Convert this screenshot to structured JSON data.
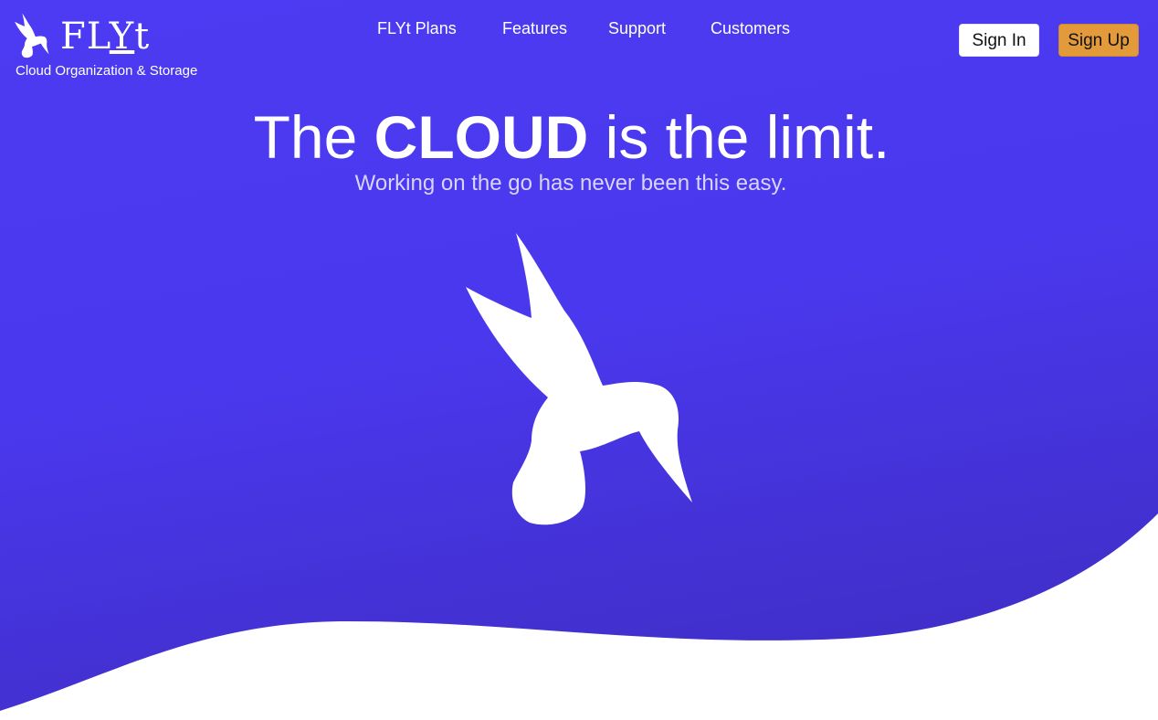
{
  "brand": {
    "name_prefix": "FL",
    "name_y": "Y",
    "name_suffix": "t",
    "tagline": "Cloud Organization & Storage"
  },
  "nav": {
    "items": [
      {
        "label": "FLYt Plans"
      },
      {
        "label": "Features"
      },
      {
        "label": "Support"
      },
      {
        "label": "Customers"
      }
    ]
  },
  "auth": {
    "sign_in": "Sign In",
    "sign_up": "Sign Up"
  },
  "hero": {
    "headline_pre": "The ",
    "headline_bold": "CLOUD",
    "headline_post": " is the limit.",
    "subheadline": "Working on the go has never been this easy."
  },
  "colors": {
    "background": "#4a38ee",
    "accent": "#e39a3a",
    "foreground": "#ffffff"
  },
  "icons": {
    "logo": "hummingbird-icon",
    "hero": "hummingbird-illustration"
  }
}
